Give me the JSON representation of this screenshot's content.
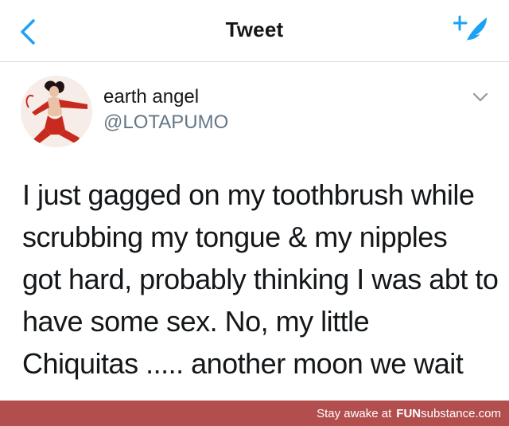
{
  "nav": {
    "back_icon": "chevron-left-icon",
    "title": "Tweet",
    "compose_icon": "compose-tweet-icon"
  },
  "tweet": {
    "author_name": "earth angel",
    "author_handle": "@LOTAPUMO",
    "menu_icon": "chevron-down-icon",
    "lines": [
      "I just gagged on my toothbrush while",
      "scrubbing my tongue & my nipples",
      "got hard, probably thinking I was abt to",
      "have some sex. No, my little",
      "Chiquitas ..... another moon we wait"
    ]
  },
  "footer": {
    "prefix": "Stay awake at",
    "brand_fun": "FUN",
    "brand_rest": "substance.com"
  },
  "colors": {
    "accent": "#1da1f2",
    "footer": "#b34e4f",
    "muted": "#657786"
  }
}
